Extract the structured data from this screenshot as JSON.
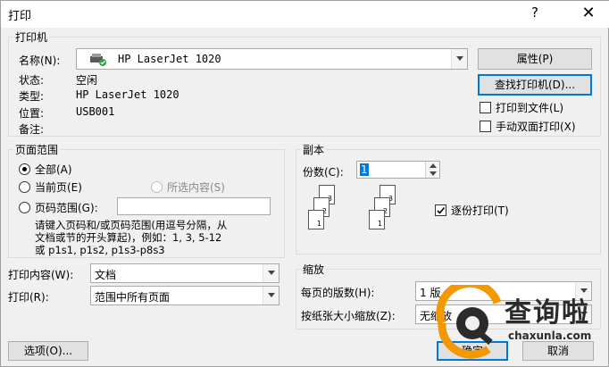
{
  "dialog": {
    "title": "打印",
    "help_glyph": "?",
    "close_glyph": "✕"
  },
  "printer": {
    "group_label": "打印机",
    "name_label": "名称(N):",
    "name_value": "HP LaserJet 1020",
    "properties_button": "属性(P)",
    "find_button": "查找打印机(D)...",
    "status_label": "状态:",
    "status_value": "空闲",
    "type_label": "类型:",
    "type_value": "HP LaserJet 1020",
    "location_label": "位置:",
    "location_value": "USB001",
    "comment_label": "备注:",
    "print_to_file": "打印到文件(L)",
    "manual_duplex": "手动双面打印(X)"
  },
  "page_range": {
    "group_label": "页面范围",
    "all": "全部(A)",
    "current_page": "当前页(E)",
    "selection": "所选内容(S)",
    "pages": "页码范围(G):",
    "pages_value": "",
    "hint_line1": "请键入页码和/或页码范围(用逗号分隔，从",
    "hint_line2": "文档或节的开头算起)，例如：1, 3, 5-12",
    "hint_line3": "或 p1s1, p1s2, p1s3-p8s3"
  },
  "print_what": {
    "label": "打印内容(W):",
    "value": "文档"
  },
  "print": {
    "label": "打印(R):",
    "value": "范围中所有页面"
  },
  "copies": {
    "group_label": "副本",
    "count_label": "份数(C):",
    "count_value": "1",
    "collate": "逐份打印(T)",
    "collate_checked": true,
    "page_numbers": [
      "1",
      "2",
      "3"
    ]
  },
  "zoom": {
    "group_label": "缩放",
    "pages_per_sheet_label": "每页的版数(H):",
    "pages_per_sheet_value": "1 版",
    "scale_label": "按纸张大小缩放(Z):",
    "scale_value": "无缩放"
  },
  "footer": {
    "options_button": "选项(O)...",
    "ok_button": "确定",
    "cancel_button": "取消"
  },
  "watermark": {
    "text": "查询啦",
    "url": "chaxunla.com"
  },
  "colors": {
    "accent": "#0078d7",
    "watermark_orange": "#f39800",
    "watermark_dark": "#2b2b2b"
  }
}
